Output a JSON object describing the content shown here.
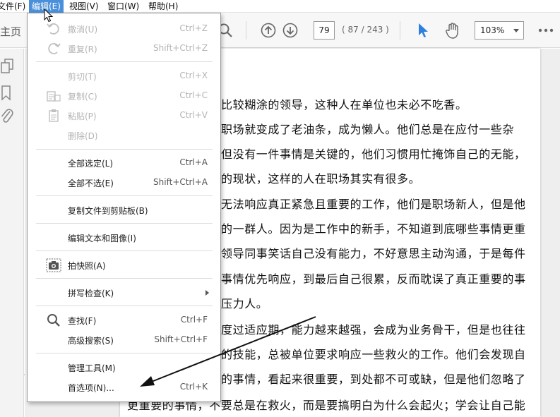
{
  "menubar": {
    "items": [
      {
        "label": "文件(F)"
      },
      {
        "label": "编辑(E)"
      },
      {
        "label": "视图(V)"
      },
      {
        "label": "窗口(W)"
      },
      {
        "label": "帮助(H)"
      }
    ]
  },
  "toolbar": {
    "home_label": "主页",
    "page_number": "79",
    "page_count": "( 87 / 243 )",
    "zoom": "103%"
  },
  "edit_menu": {
    "items": [
      {
        "label": "撤消(U)",
        "shortcut": "Ctrl+Z",
        "icon": "undo-icon",
        "disabled": true
      },
      {
        "label": "重复(R)",
        "shortcut": "Shift+Ctrl+Z",
        "icon": "redo-icon",
        "disabled": true
      },
      {
        "label": "剪切(T)",
        "shortcut": "Ctrl+X",
        "disabled": true
      },
      {
        "label": "复制(C)",
        "shortcut": "Ctrl+C",
        "icon": "copy-icon",
        "disabled": true
      },
      {
        "label": "粘贴(P)",
        "shortcut": "Ctrl+V",
        "icon": "paste-icon",
        "disabled": true
      },
      {
        "label": "删除(D)",
        "shortcut": "",
        "disabled": true
      },
      {
        "label": "全部选定(L)",
        "shortcut": "Ctrl+A"
      },
      {
        "label": "全部不选(E)",
        "shortcut": "Shift+Ctrl+A"
      },
      {
        "label": "复制文件到剪贴板(B)",
        "shortcut": ""
      },
      {
        "label": "编辑文本和图像(I)",
        "shortcut": ""
      },
      {
        "label": "拍快照(A)",
        "shortcut": "",
        "icon": "camera-icon"
      },
      {
        "label": "拼写检查(K)",
        "shortcut": "",
        "submenu": true
      },
      {
        "label": "查找(F)",
        "shortcut": "Ctrl+F",
        "icon": "search-icon"
      },
      {
        "label": "高级搜索(S)",
        "shortcut": "Shift+Ctrl+F"
      },
      {
        "label": "管理工具(M)",
        "shortcut": ""
      },
      {
        "label": "首选项(N)...",
        "shortcut": "Ctrl+K"
      }
    ]
  },
  "document": {
    "lines": [
      "比较糊涂的领导，这种人在单位也未必不吃香。",
      "职场就变成了老油条，成为懒人。他们总是在应付一些杂",
      "但没有一件事情是关键的，他们习惯用忙掩饰自己的无能，",
      "的现状，这样的人在职场其实有很多。",
      "无法响应真正紧急且重要的工作，他们是职场新人，但是他",
      "的一群人。因为是工作中的新手，不知道到底哪些事情更重",
      "领导同事笑话自己没有能力，不好意思主动沟通，于是每件",
      "事情优先响应，到最后自己很累，反而耽误了真正重要的事",
      "压力人。",
      "度过适应期，能力越来越强，会成为业务骨干，但是也往往",
      "的技能，总被单位要求响应一些救火的工作。他们会发现自",
      "的事情，看起来很重要，到处都不可或缺，但是他们忽略了",
      "更重要的事情，不要总是在救火，而是要搞明白为什么会起火；学会让自己能"
    ]
  },
  "colors": {
    "menu_highlight": "#4a8fd9",
    "select_tool": "#2d7fe0"
  }
}
